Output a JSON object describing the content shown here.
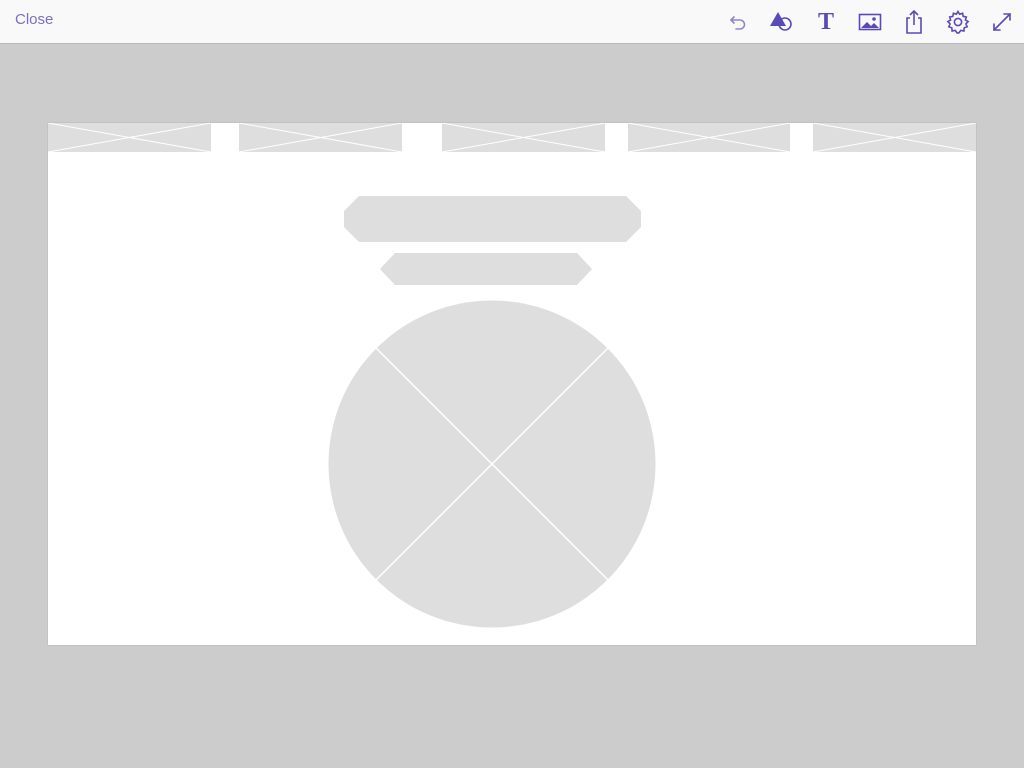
{
  "toolbar": {
    "close_label": "Close",
    "tools": [
      {
        "icon": "undo-icon"
      },
      {
        "icon": "shapes-icon"
      },
      {
        "icon": "text-icon",
        "glyph": "T"
      },
      {
        "icon": "image-icon"
      },
      {
        "icon": "share-icon"
      },
      {
        "icon": "settings-icon"
      },
      {
        "icon": "fullscreen-icon"
      }
    ]
  },
  "colors": {
    "accent": "#5a4ab8",
    "accent_light": "#8f84cf",
    "toolbar_bg": "#f9f9f9",
    "workspace_bg": "#cccccc",
    "placeholder_fill": "#dedede",
    "placeholder_stroke": "#ffffff",
    "canvas_bg": "#ffffff"
  },
  "canvas": {
    "nav_placeholders": 5,
    "title_placeholder": "heading",
    "subtitle_placeholder": "subheading",
    "image_placeholder": "circle"
  }
}
